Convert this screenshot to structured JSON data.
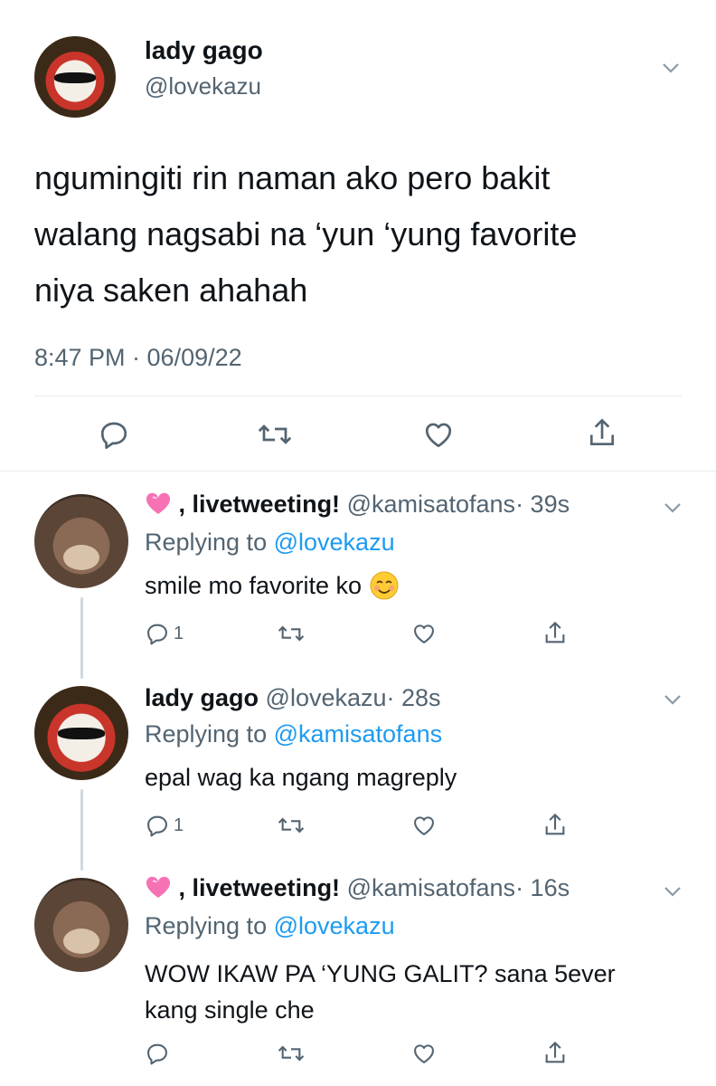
{
  "main_tweet": {
    "display_name": "lady gago",
    "handle": "@lovekazu",
    "text_lines": [
      "ngumingiti rin naman ako pero bakit",
      "walang nagsabi na ‘yun ‘yung favorite",
      "niya saken ahahah"
    ],
    "timestamp": "8:47 PM · 06/09/22"
  },
  "replies": [
    {
      "display_name": ", livetweeting!",
      "handle": "@kamisatofans",
      "time": "· 39s",
      "replying_prefix": "Replying to",
      "replying_to": "@lovekazu",
      "text": "smile mo favorite ko",
      "reply_count": "1"
    },
    {
      "display_name": "lady gago",
      "handle": "@lovekazu",
      "time": "· 28s",
      "replying_prefix": "Replying to",
      "replying_to": "@kamisatofans",
      "text": "epal wag ka ngang magreply",
      "reply_count": "1"
    },
    {
      "display_name": ", livetweeting!",
      "handle": "@kamisatofans",
      "time": "· 16s",
      "replying_prefix": "Replying to",
      "replying_to": "@lovekazu",
      "text_lines": [
        "WOW IKAW PA ‘YUNG GALIT? sana 5ever",
        "kang single che"
      ]
    }
  ],
  "colors": {
    "link": "#1d9bf0",
    "muted": "#536471",
    "text": "#0f1419",
    "divider": "#e6ecf0"
  },
  "icons": [
    "chevron-down-icon",
    "reply-icon",
    "retweet-icon",
    "like-icon",
    "share-icon",
    "sparkling-heart-icon",
    "smiling-face-icon"
  ]
}
